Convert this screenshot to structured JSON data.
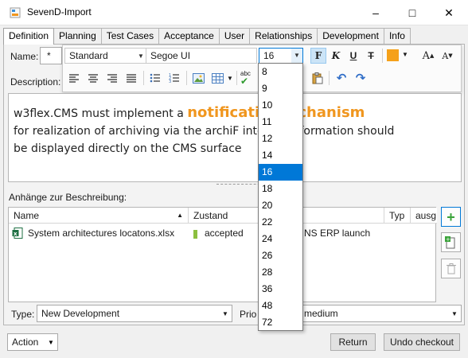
{
  "window": {
    "title": "SevenD-Import",
    "minimize": "–",
    "maximize": "□",
    "close": "✕"
  },
  "tabs": [
    "Definition",
    "Planning",
    "Test Cases",
    "Acceptance",
    "User",
    "Relationships",
    "Development",
    "Info"
  ],
  "active_tab": "Definition",
  "form": {
    "name_label": "Name:",
    "name_value": "*",
    "description_label": "Description:"
  },
  "toolbar": {
    "style_value": "Standard",
    "font_value": "Segoe UI",
    "size_value": "16",
    "bold": "F",
    "italic": "K",
    "underline": "U",
    "strike": "T",
    "accent_color": "#f5a11a",
    "grow_font": "A",
    "shrink_font": "A",
    "abc": "abc",
    "icons": [
      "align-left-icon",
      "align-center-icon",
      "align-right-icon",
      "justify-icon",
      "bullets-icon",
      "numbering-icon",
      "image-icon",
      "table-icon",
      "spellcheck-icon",
      "paste-icon",
      "undo-icon",
      "redo-icon"
    ]
  },
  "editor": {
    "line1_pre": "w3flex.CMS must implement a ",
    "line1_highlight": "notificati",
    "line1_post": "echanism",
    "line2_pre": "for realization of archiving via the archiF inte",
    "line2_post": "nformation should",
    "line3": "be displayed directly on the CMS surface",
    "highlight_color": "#f0961e"
  },
  "attachments": {
    "title": "Anhänge zur Beschreibung:",
    "columns": [
      "Name",
      "Zustand",
      "",
      "Typ",
      "ausg"
    ],
    "rows": [
      {
        "name": "System architectures locatons.xlsx",
        "status": "accepted",
        "release": "NS ERP launch",
        "type": "",
        "status_color": "#8cbf3f"
      }
    ]
  },
  "bottom": {
    "type_label": "Type:",
    "type_value": "New Development",
    "priority_label": "Prio",
    "priority_value": "medium",
    "action_value": "Action",
    "return_label": "Return",
    "undo_checkout_label": "Undo checkout"
  },
  "font_sizes": [
    "8",
    "9",
    "10",
    "11",
    "12",
    "14",
    "16",
    "18",
    "20",
    "22",
    "24",
    "26",
    "28",
    "36",
    "48",
    "72"
  ],
  "font_size_selected": "16"
}
